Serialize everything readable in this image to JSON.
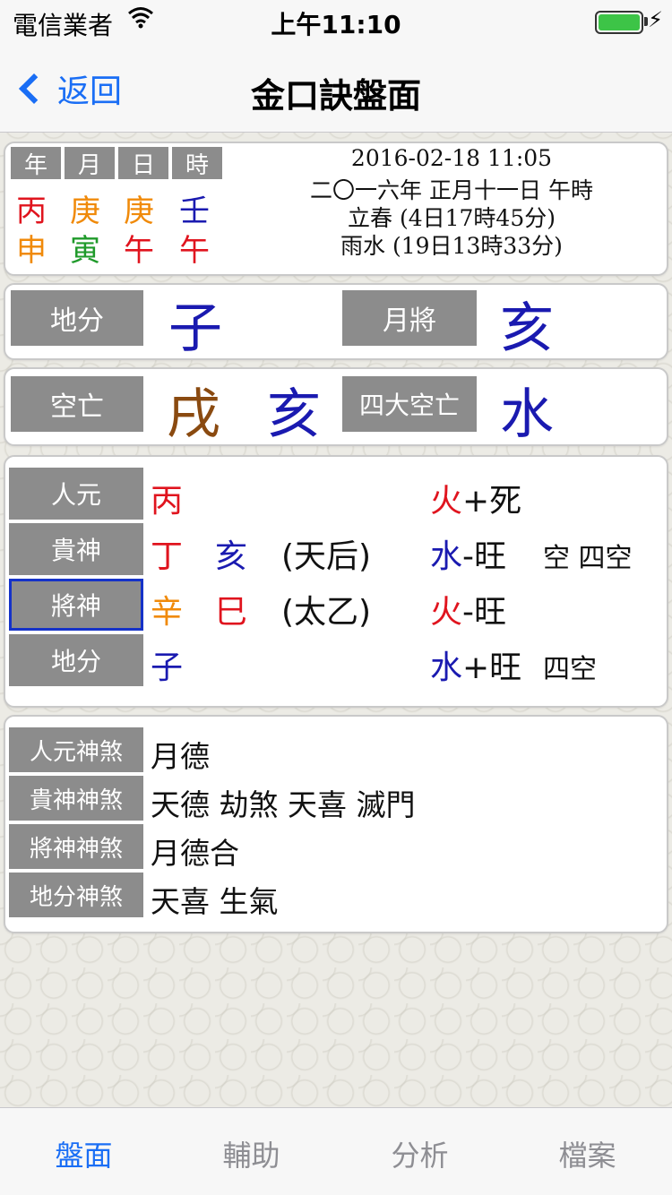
{
  "status": {
    "carrier": "電信業者",
    "time": "上午11:10"
  },
  "nav": {
    "back": "返回",
    "title": "金口訣盤面"
  },
  "pillars": {
    "headers": [
      "年",
      "月",
      "日",
      "時"
    ],
    "stems": [
      {
        "text": "丙",
        "color": "#e0141e"
      },
      {
        "text": "庚",
        "color": "#f08a0a"
      },
      {
        "text": "庚",
        "color": "#f08a0a"
      },
      {
        "text": "壬",
        "color": "#1a1ab0"
      }
    ],
    "branches": [
      {
        "text": "申",
        "color": "#f08a0a"
      },
      {
        "text": "寅",
        "color": "#1f9a2a"
      },
      {
        "text": "午",
        "color": "#e0141e"
      },
      {
        "text": "午",
        "color": "#e0141e"
      }
    ]
  },
  "date": {
    "datetime": "2016-02-18 11:05",
    "lunar": "二〇一六年 正月十一日 午時",
    "term1": "立春 (4日17時45分)",
    "term2": "雨水 (19日13時33分)"
  },
  "difen_row": {
    "label1": "地分",
    "value1": "子",
    "color1": "#1a1ab0",
    "label2": "月將",
    "value2": "亥",
    "color2": "#1a1ab0"
  },
  "kongwang_row": {
    "label1": "空亡",
    "value1": "戌",
    "color1": "#8a4a10",
    "value2": "亥",
    "color2": "#1a1ab0",
    "label2": "四大空亡",
    "value3": "水",
    "color3": "#1a1ab0"
  },
  "plate": {
    "rows": [
      {
        "label": "人元",
        "g1": "丙",
        "g1_color": "#e0141e",
        "g2": "",
        "g2_color": "#000",
        "deity": "",
        "element": "火",
        "element_color": "#e0141e",
        "state": "+死",
        "note": ""
      },
      {
        "label": "貴神",
        "g1": "丁",
        "g1_color": "#e0141e",
        "g2": "亥",
        "g2_color": "#1a1ab0",
        "deity": "(天后)",
        "element": "水",
        "element_color": "#1a1ab0",
        "state": "-旺",
        "note": "空 四空"
      },
      {
        "label": "將神",
        "g1": "辛",
        "g1_color": "#f08a0a",
        "g2": "巳",
        "g2_color": "#e0141e",
        "deity": "(太乙)",
        "element": "火",
        "element_color": "#e0141e",
        "state": "-旺",
        "note": ""
      },
      {
        "label": "地分",
        "g1": "子",
        "g1_color": "#1a1ab0",
        "g2": "",
        "g2_color": "#000",
        "deity": "",
        "element": "水",
        "element_color": "#1a1ab0",
        "state": "+旺",
        "note": "四空"
      }
    ]
  },
  "shensha": {
    "rows": [
      {
        "label": "人元神煞",
        "text": "月德"
      },
      {
        "label": "貴神神煞",
        "text": "天德 劫煞 天喜 滅門"
      },
      {
        "label": "將神神煞",
        "text": "月德合"
      },
      {
        "label": "地分神煞",
        "text": "天喜 生氣"
      }
    ]
  },
  "tabs": [
    "盤面",
    "輔助",
    "分析",
    "檔案"
  ],
  "accent": "#1a6ef5"
}
